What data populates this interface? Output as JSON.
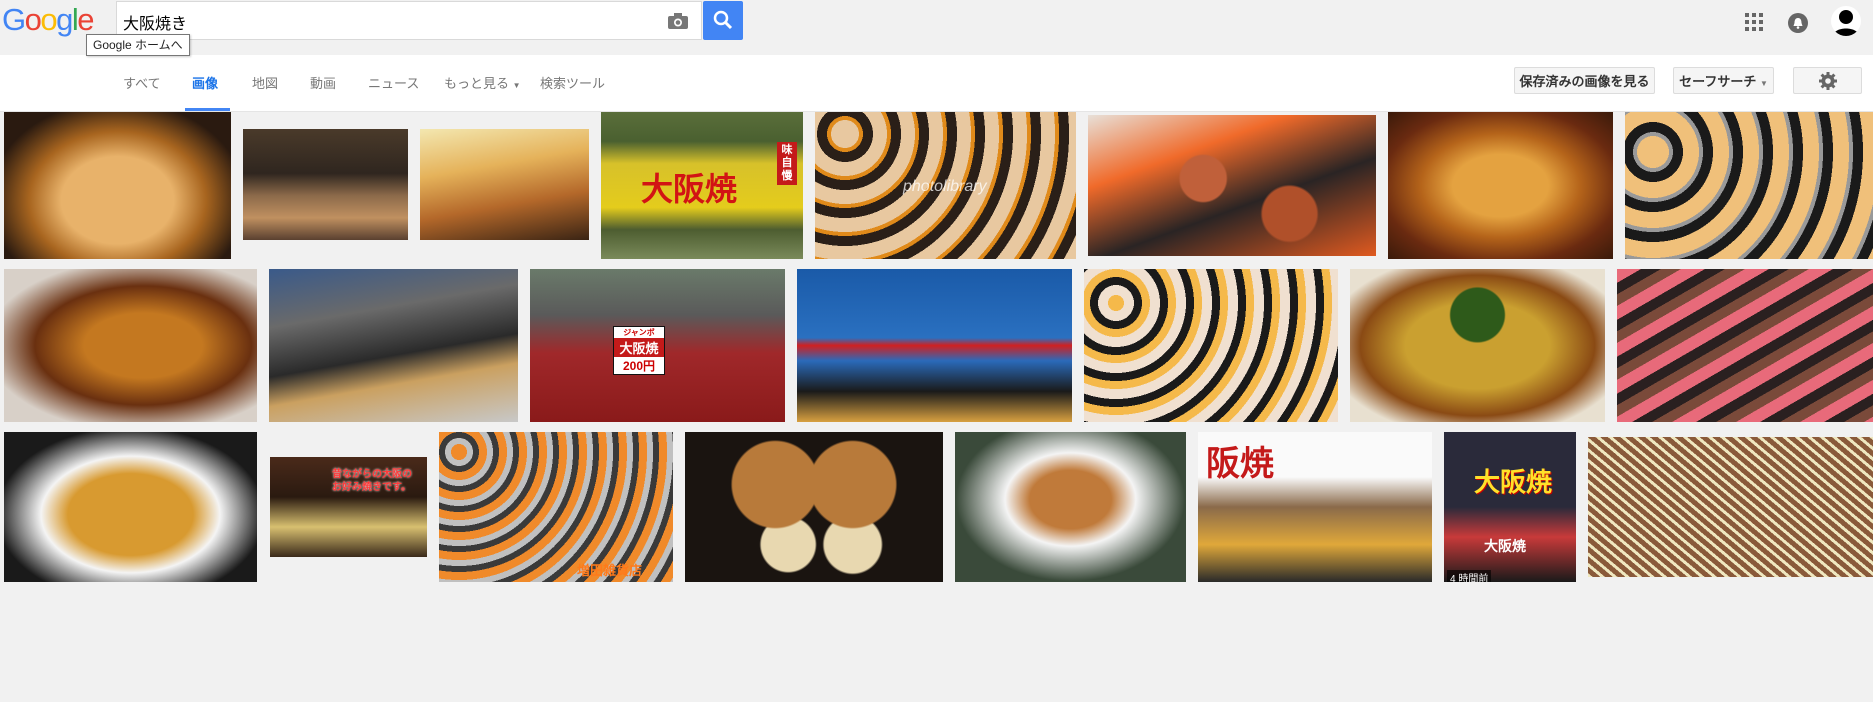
{
  "header": {
    "logo_letters": [
      "G",
      "o",
      "o",
      "g",
      "l",
      "e"
    ],
    "logo_tooltip": "Google ホームへ",
    "search_query": "大阪焼き"
  },
  "nav": {
    "all": "すべて",
    "images": "画像",
    "maps": "地図",
    "videos": "動画",
    "news": "ニュース",
    "more": "もっと見る",
    "tools": "検索ツール"
  },
  "toolbar": {
    "saved_images": "保存済みの画像を見る",
    "safe_search": "セーフサーチ"
  },
  "images_text": {
    "sign_osaka": "大阪焼",
    "sign_ajijiman": "味自慢",
    "watermark_photolibrary": "photolibrary",
    "sign_jumbo": "ジャンボ",
    "sign_osaka2": "大阪焼",
    "sign_price": "200円",
    "caption_old": "昔ながらの大阪の",
    "caption_old2": "お好み焼きです。",
    "shop_name": "増田雑貨店",
    "sign_hanmaru": "阪焼",
    "sign_osaka3": "大阪焼",
    "sign_osaka4": "大阪焼",
    "time_badge": "4 時間前"
  },
  "colors": {
    "accent": "#4285f4"
  }
}
